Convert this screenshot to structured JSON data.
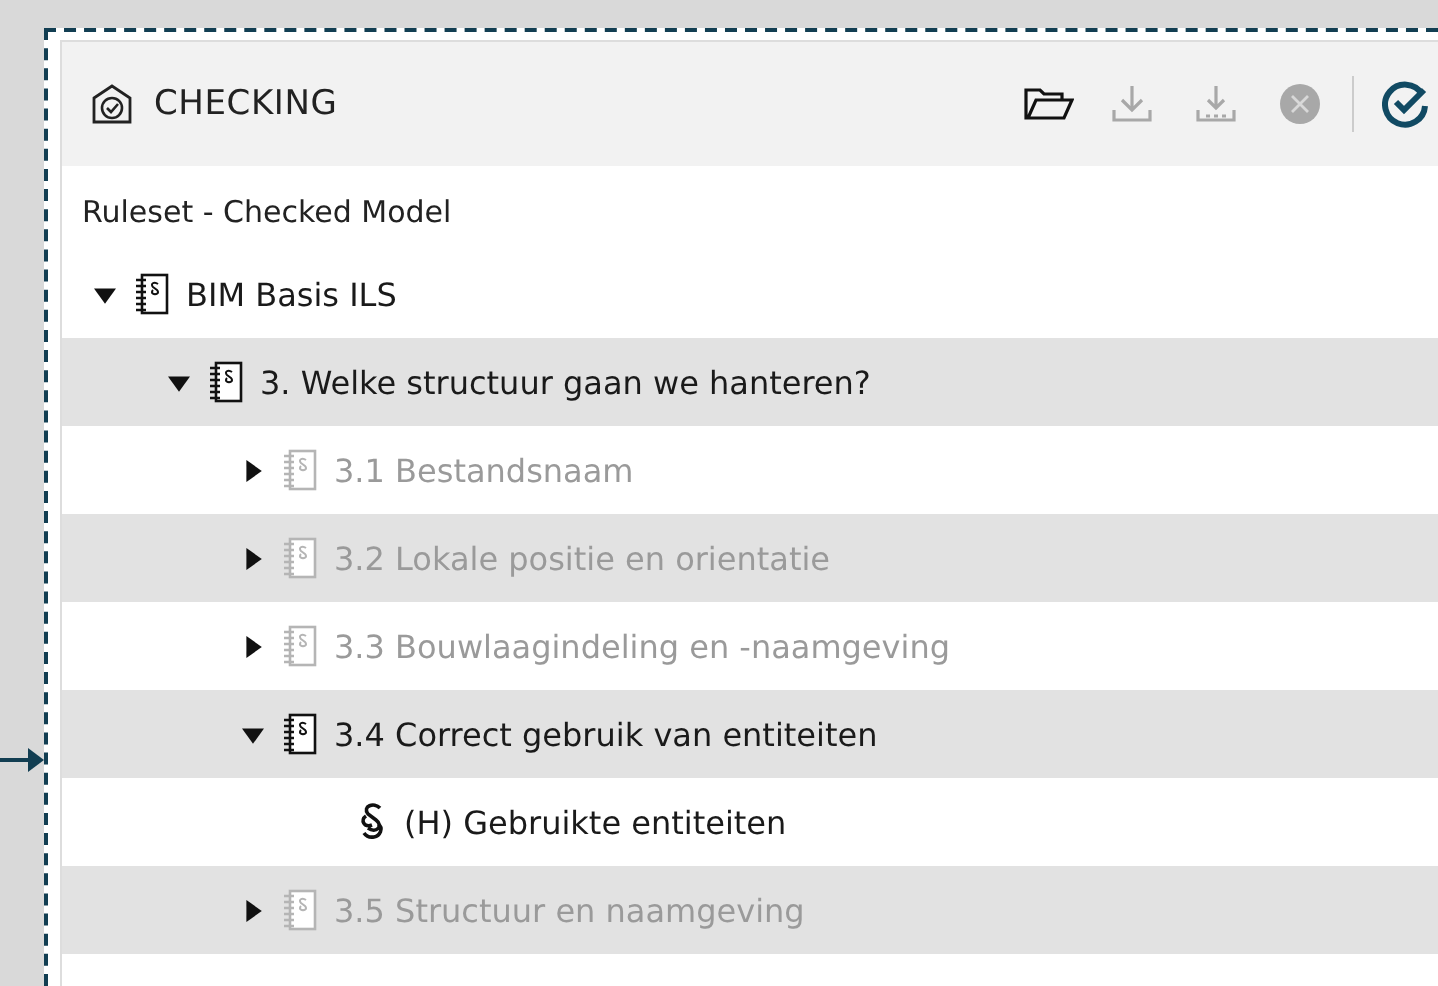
{
  "panel": {
    "title": "CHECKING",
    "toolbar": [
      {
        "kind": "open",
        "disabled": false
      },
      {
        "kind": "download",
        "disabled": true
      },
      {
        "kind": "export",
        "disabled": true
      },
      {
        "kind": "cancel",
        "disabled": true
      },
      {
        "kind": "check",
        "disabled": false
      }
    ],
    "subtitle": "Ruleset - Checked Model",
    "tree": [
      {
        "label": "BIM Basis ILS",
        "kind": "ruleset",
        "disabled": false,
        "expanded": true,
        "children": [
          {
            "label": "3. Welke structuur gaan we hanteren?",
            "kind": "ruleset",
            "disabled": false,
            "expanded": true,
            "children": [
              {
                "label": "3.1 Bestandsnaam",
                "kind": "ruleset",
                "disabled": true,
                "expanded": false
              },
              {
                "label": "3.2 Lokale positie en orientatie",
                "kind": "ruleset",
                "disabled": true,
                "expanded": false
              },
              {
                "label": "3.3 Bouwlaagindeling en -naamgeving",
                "kind": "ruleset",
                "disabled": true,
                "expanded": false
              },
              {
                "label": "3.4 Correct gebruik van entiteiten",
                "kind": "ruleset",
                "disabled": false,
                "expanded": true,
                "children": [
                  {
                    "label": "(H) Gebruikte entiteiten",
                    "kind": "rule",
                    "disabled": false
                  }
                ]
              },
              {
                "label": "3.5 Structuur en naamgeving",
                "kind": "ruleset",
                "disabled": true,
                "expanded": false
              }
            ]
          }
        ]
      }
    ]
  }
}
